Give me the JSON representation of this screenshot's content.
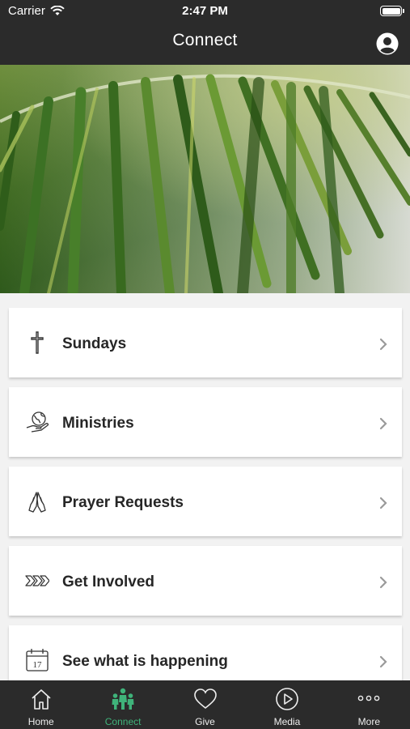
{
  "status_bar": {
    "carrier": "Carrier",
    "time": "2:47 PM"
  },
  "nav": {
    "title": "Connect"
  },
  "items": [
    {
      "label": "Sundays",
      "icon": "cross-icon"
    },
    {
      "label": "Ministries",
      "icon": "hand-globe-icon"
    },
    {
      "label": "Prayer Requests",
      "icon": "praying-hands-icon"
    },
    {
      "label": "Get Involved",
      "icon": "chevrons-icon"
    },
    {
      "label": "See what is happening",
      "icon": "calendar-icon",
      "icon_text": "17"
    }
  ],
  "tabs": [
    {
      "label": "Home",
      "icon": "home-icon"
    },
    {
      "label": "Connect",
      "icon": "people-icon",
      "active": true
    },
    {
      "label": "Give",
      "icon": "heart-icon"
    },
    {
      "label": "Media",
      "icon": "play-icon"
    },
    {
      "label": "More",
      "icon": "more-icon"
    }
  ],
  "colors": {
    "bar": "#2b2b2b",
    "active_tab": "#3fb37a",
    "label": "#262626"
  }
}
